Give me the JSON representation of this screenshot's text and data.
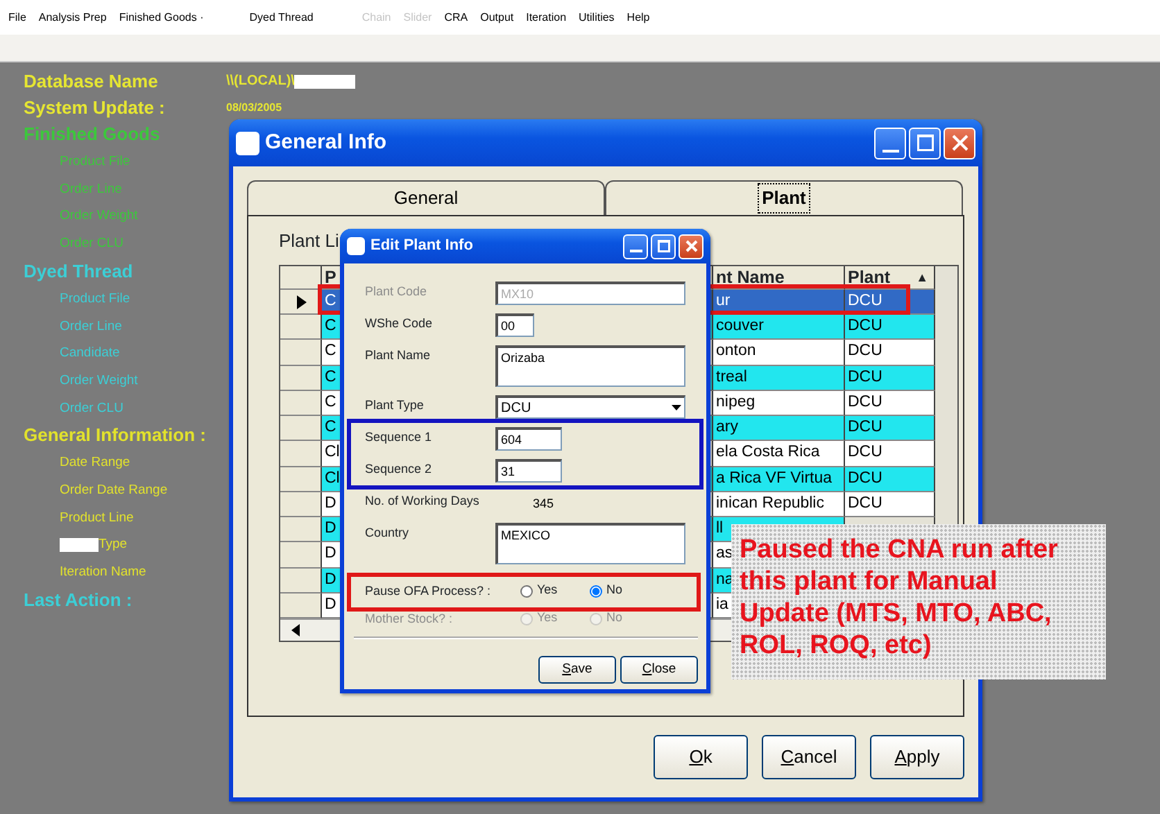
{
  "menu": [
    {
      "label": "File",
      "disabled": false
    },
    {
      "label": "Analysis Prep",
      "disabled": false
    },
    {
      "label": "Finished Goods ·",
      "disabled": false
    },
    {
      "label": "Dyed Thread",
      "disabled": false
    },
    {
      "label": "Chain",
      "disabled": true
    },
    {
      "label": "Slider",
      "disabled": true
    },
    {
      "label": "CRA",
      "disabled": false
    },
    {
      "label": "Output",
      "disabled": false
    },
    {
      "label": "Iteration",
      "disabled": false
    },
    {
      "label": "Utilities",
      "disabled": false
    },
    {
      "label": "Help",
      "disabled": false
    }
  ],
  "header_fields": [
    {
      "label": "Database Name",
      "value": "\\\\(LOCAL)\\",
      "redacted_suffix": true
    },
    {
      "label": "System Update :",
      "value": "08/03/2005"
    }
  ],
  "sections": [
    {
      "title": "Finished Goods",
      "color": "#3cc83c",
      "items": [
        {
          "label": "Product File"
        },
        {
          "label": "Order Line"
        },
        {
          "label": "Order Weight"
        },
        {
          "label": "Order CLU"
        }
      ]
    },
    {
      "title": "Dyed Thread",
      "color": "#3ccfd6",
      "items": [
        {
          "label": "Product File"
        },
        {
          "label": "Order Line"
        },
        {
          "label": "Candidate"
        },
        {
          "label": "Order Weight"
        },
        {
          "label": "Order CLU"
        }
      ]
    },
    {
      "title": "General Information :",
      "color": "#e2e22c",
      "items": [
        {
          "label": "Date Range"
        },
        {
          "label": "Order Date Range"
        },
        {
          "label": "Product Line"
        },
        {
          "label": "Type",
          "redacted_prefix": true
        },
        {
          "label": "Iteration Name"
        }
      ]
    },
    {
      "title": "Last Action :",
      "color": "#3ccfd6"
    }
  ],
  "general_info": {
    "title": "General Info",
    "tabs": [
      {
        "label": "General",
        "selected": false
      },
      {
        "label": "Plant",
        "selected": true
      }
    ],
    "list_label": "Plant Li",
    "columns": [
      "P",
      "nt Name",
      "Plant"
    ],
    "sort_indicator": "▲",
    "rows": [
      {
        "code": "C",
        "name": "ur",
        "plant": "DCU",
        "selected": true
      },
      {
        "code": "C",
        "name": "couver",
        "plant": "DCU",
        "selected": false
      },
      {
        "code": "C",
        "name": "onton",
        "plant": "DCU",
        "selected": false
      },
      {
        "code": "C",
        "name": "treal",
        "plant": "DCU",
        "selected": false
      },
      {
        "code": "C",
        "name": "nipeg",
        "plant": "DCU",
        "selected": false
      },
      {
        "code": "C",
        "name": "ary",
        "plant": "DCU",
        "selected": false
      },
      {
        "code": "Cl",
        "name": "ela Costa Rica",
        "plant": "DCU",
        "selected": false
      },
      {
        "code": "Cl",
        "name": "a Rica VF Virtua",
        "plant": "DCU",
        "selected": false
      },
      {
        "code": "D",
        "name": "inican Republic",
        "plant": "DCU",
        "selected": false
      },
      {
        "code": "D",
        "name": "ll",
        "selected": false
      },
      {
        "code": "D",
        "name": "as",
        "selected": false
      },
      {
        "code": "D",
        "name": "na",
        "selected": false
      },
      {
        "code": "D",
        "name": "ia",
        "selected": false
      }
    ],
    "buttons": [
      "Ok",
      "Cancel",
      "Apply"
    ]
  },
  "edit_plant": {
    "title": "Edit Plant Info",
    "fields": [
      {
        "kind": "text",
        "label": "Plant Code",
        "value": "MX10",
        "disabled": true
      },
      {
        "kind": "short",
        "label": "WShe Code",
        "value": "00",
        "disabled": false
      },
      {
        "kind": "multiline",
        "label": "Plant Name",
        "value": "Orizaba",
        "disabled": false
      },
      {
        "kind": "dropdown",
        "label": "Plant Type",
        "value": "DCU",
        "disabled": false
      },
      {
        "kind": "number",
        "label": "Sequence 1",
        "value": "604",
        "disabled": false
      },
      {
        "kind": "number",
        "label": "Sequence 2",
        "value": "31",
        "disabled": false
      },
      {
        "kind": "plain",
        "label": "No. of Working Days",
        "value": "345",
        "disabled": false
      },
      {
        "kind": "multiline",
        "label": "Country",
        "value": "MEXICO",
        "disabled": false
      },
      {
        "kind": "radio",
        "label": "Pause OFA Process? :",
        "disabled": false,
        "options": [
          {
            "label": "Yes",
            "selected": false
          },
          {
            "label": "No",
            "selected": true
          }
        ]
      },
      {
        "kind": "radio",
        "label": "Mother Stock? :",
        "disabled": true,
        "options": [
          {
            "label": "Yes",
            "selected": false
          },
          {
            "label": "No",
            "selected": false
          }
        ]
      }
    ],
    "buttons": [
      "Save",
      "Close"
    ]
  },
  "annotations": [
    {
      "kind": "frame",
      "color": "#e01818"
    },
    {
      "kind": "frame",
      "color": "#1414c0"
    },
    {
      "kind": "frame",
      "color": "#e01818"
    },
    {
      "kind": "callout",
      "text": "Paused the CNA run after this plant for Manual Update (MTS, MTO, ABC, ROL, ROQ, etc)"
    }
  ]
}
